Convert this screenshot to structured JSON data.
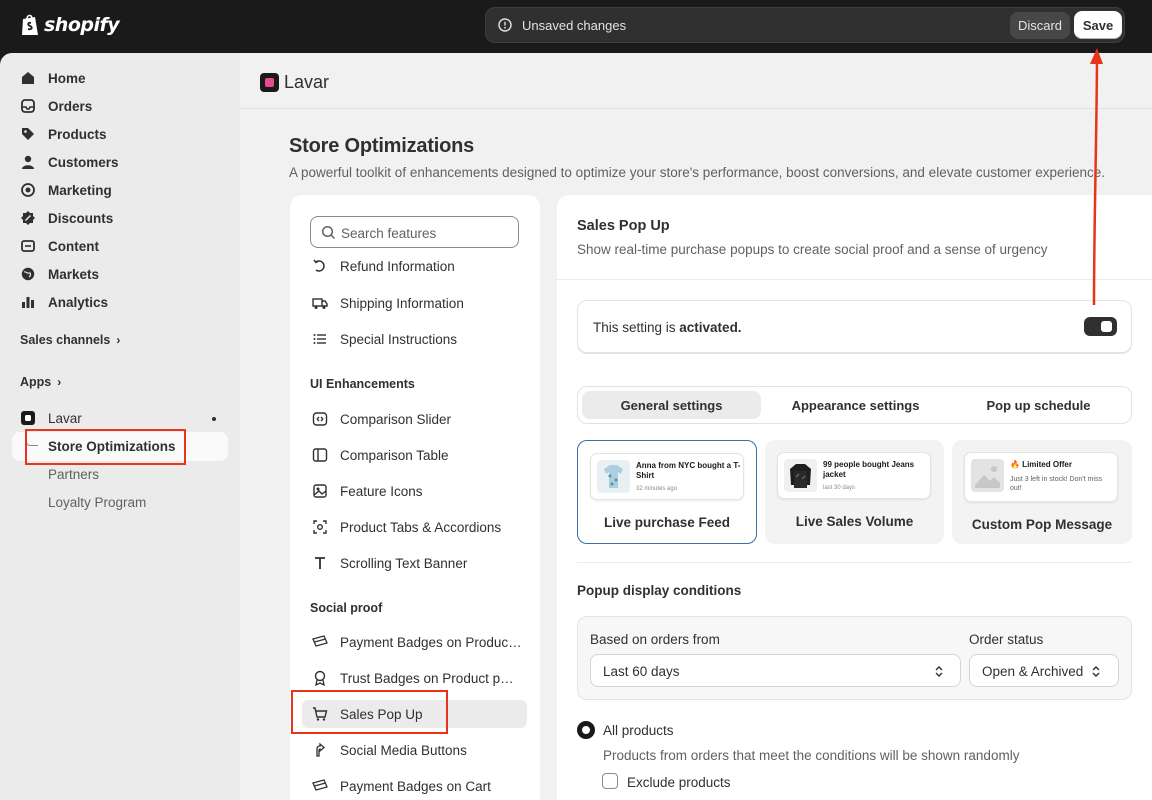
{
  "topbar": {
    "brand": "shopify",
    "unsaved_text": "Unsaved changes",
    "discard_label": "Discard",
    "save_label": "Save"
  },
  "sidebar": {
    "items": [
      {
        "label": "Home",
        "icon": "home-icon"
      },
      {
        "label": "Orders",
        "icon": "inbox-icon"
      },
      {
        "label": "Products",
        "icon": "tag-icon"
      },
      {
        "label": "Customers",
        "icon": "person-icon"
      },
      {
        "label": "Marketing",
        "icon": "target-icon"
      },
      {
        "label": "Discounts",
        "icon": "discount-icon"
      },
      {
        "label": "Content",
        "icon": "content-icon"
      },
      {
        "label": "Markets",
        "icon": "globe-icon"
      },
      {
        "label": "Analytics",
        "icon": "bar-chart-icon"
      }
    ],
    "sales_channels": "Sales channels",
    "apps": "Apps",
    "app_name": "Lavar",
    "sub_items": [
      "Store Optimizations",
      "Partners",
      "Loyalty Program"
    ]
  },
  "app_header": {
    "name": "Lavar"
  },
  "page": {
    "title": "Store Optimizations",
    "subtitle": "A powerful toolkit of enhancements designed to optimize your store's performance, boost conversions, and elevate customer experience."
  },
  "features": {
    "search_placeholder": "Search features",
    "items_top": [
      {
        "label": "Refund Information",
        "icon": "refund-icon"
      },
      {
        "label": "Shipping Information",
        "icon": "truck-icon"
      },
      {
        "label": "Special Instructions",
        "icon": "list-icon"
      }
    ],
    "ui_heading": "UI Enhancements",
    "ui_items": [
      {
        "label": "Comparison Slider",
        "icon": "slider-icon"
      },
      {
        "label": "Comparison Table",
        "icon": "table-icon"
      },
      {
        "label": "Feature Icons",
        "icon": "image-icon"
      },
      {
        "label": "Product Tabs & Accordions",
        "icon": "tabs-icon"
      },
      {
        "label": "Scrolling Text Banner",
        "icon": "text-icon"
      }
    ],
    "social_heading": "Social proof",
    "social_items": [
      {
        "label": "Payment Badges on Produc…",
        "icon": "payment-badge-icon"
      },
      {
        "label": "Trust Badges on Product p…",
        "icon": "badge-icon"
      },
      {
        "label": "Sales Pop Up",
        "icon": "cart-icon"
      },
      {
        "label": "Social Media Buttons",
        "icon": "social-icon"
      },
      {
        "label": "Payment Badges on Cart",
        "icon": "payment-badge-icon"
      }
    ]
  },
  "panel": {
    "title": "Sales Pop Up",
    "subtitle": "Show real-time purchase popups to create social proof and a sense of urgency",
    "activated_prefix": "This setting is ",
    "activated_state": "activated.",
    "toggle_on": true,
    "tabs": [
      "General settings",
      "Appearance settings",
      "Pop up schedule"
    ],
    "selected_tab": "General settings",
    "cards": [
      {
        "label": "Live purchase Feed",
        "preview_title": "Anna from NYC bought a T-Shirt",
        "preview_meta": "32 minutes ago",
        "selected": true
      },
      {
        "label": "Live Sales Volume",
        "preview_title": "99 people bought Jeans jacket",
        "preview_meta": "last 30 days",
        "selected": false
      },
      {
        "label": "Custom Pop Message",
        "preview_title": "🔥 Limited Offer",
        "preview_meta": "Just 3 left in stock! Don't miss out!",
        "selected": false
      }
    ],
    "conditions_title": "Popup display conditions",
    "orders_from_label": "Based on orders from",
    "orders_from_value": "Last 60 days",
    "order_status_label": "Order status",
    "order_status_value": "Open & Archived",
    "radio_label": "All products",
    "radio_help": "Products from orders that meet the conditions will be shown randomly",
    "exclude_label": "Exclude products"
  },
  "colors": {
    "annotation": "#e8341c",
    "accent_selected": "#3a6ea5",
    "topbar_bg": "#1a1a1a"
  }
}
